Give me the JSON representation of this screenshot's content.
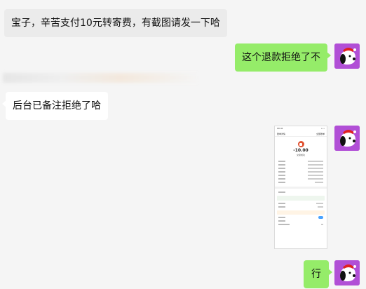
{
  "messages": [
    {
      "side": "left",
      "text": "宝子，辛苦支付10元转寄费，有截图请发一下哈"
    },
    {
      "side": "right",
      "text": "这个退款拒绝了不"
    },
    {
      "side": "left",
      "text": "后台已备注拒绝了哈"
    },
    {
      "side": "right",
      "type": "image"
    },
    {
      "side": "right",
      "text": "行"
    }
  ],
  "screenshot": {
    "status_time": "09:41",
    "status_signal": "•••",
    "header_left": "账单详情",
    "header_right": "全部账单",
    "amount": "-10.00",
    "status_text": "交易成功"
  },
  "colors": {
    "background": "#f5f5f5",
    "left_bubble": "#ebebeb",
    "right_bubble": "#95ec69",
    "avatar_bg": "#b14fd6"
  }
}
